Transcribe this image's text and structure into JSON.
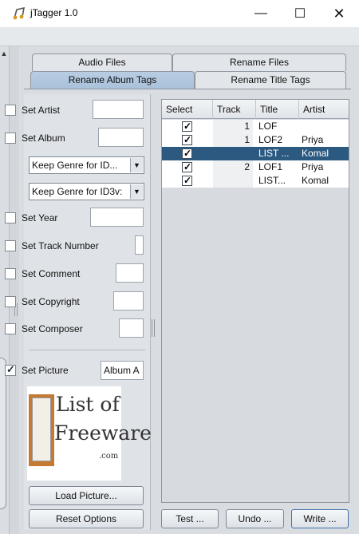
{
  "window": {
    "title": "jTagger 1.0",
    "min_symbol": "—",
    "max_symbol": "☐",
    "close_symbol": "✕"
  },
  "tabs": {
    "audio_files": "Audio Files",
    "rename_files": "Rename Files",
    "rename_album_tags": "Rename Album Tags",
    "rename_title_tags": "Rename Title Tags",
    "active": "Rename Album Tags"
  },
  "options": {
    "set_artist": {
      "label": "Set Artist",
      "checked": false,
      "value": ""
    },
    "set_album": {
      "label": "Set Album",
      "checked": false,
      "value": ""
    },
    "genre_combo_1": "Keep Genre for ID...",
    "genre_combo_2": "Keep Genre for ID3v:",
    "set_year": {
      "label": "Set Year",
      "checked": false,
      "value": ""
    },
    "set_track_number": {
      "label": "Set Track Number",
      "checked": false,
      "value": ""
    },
    "set_comment": {
      "label": "Set Comment",
      "checked": false,
      "value": ""
    },
    "set_copyright": {
      "label": "Set Copyright",
      "checked": false,
      "value": ""
    },
    "set_composer": {
      "label": "Set Composer",
      "checked": false,
      "value": ""
    },
    "set_picture": {
      "label": "Set Picture",
      "checked": true,
      "value": "Album A"
    }
  },
  "logo": {
    "line1": "List of",
    "line2": "Freeware",
    "line3": ".com"
  },
  "buttons": {
    "load_picture": "Load Picture...",
    "reset_options": "Reset Options",
    "test": "Test ...",
    "undo": "Undo ...",
    "write": "Write ..."
  },
  "table": {
    "columns": [
      "Select",
      "Track",
      "Title",
      "Artist"
    ],
    "rows": [
      {
        "select": true,
        "track": "1",
        "title": "LOF",
        "artist": "",
        "selected": false
      },
      {
        "select": true,
        "track": "1",
        "title": "LOF2",
        "artist": "Priya",
        "selected": false
      },
      {
        "select": true,
        "track": "",
        "title": "LIST ...",
        "artist": "Komal",
        "selected": true
      },
      {
        "select": true,
        "track": "2",
        "title": "LOF1",
        "artist": "Priya",
        "selected": false
      },
      {
        "select": true,
        "track": "",
        "title": "LIST...",
        "artist": "Komal",
        "selected": false
      }
    ]
  },
  "colors": {
    "selected_row": "#2c5980",
    "active_tab": "#a9c1da"
  }
}
